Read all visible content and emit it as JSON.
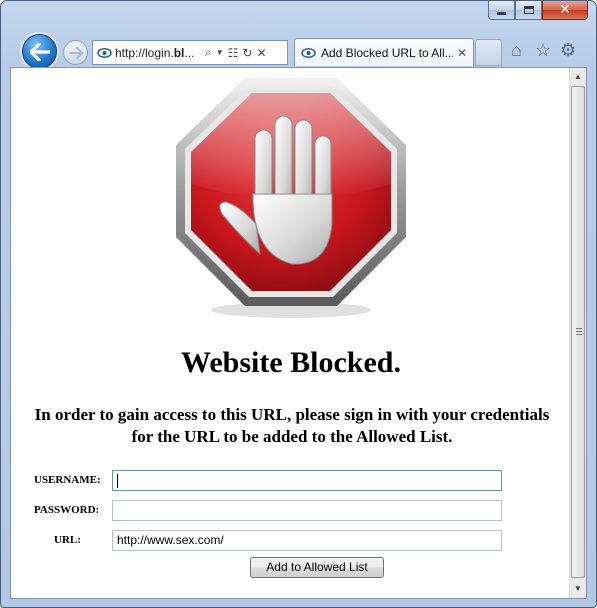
{
  "browser": {
    "address_url_prefix": "http://login.",
    "address_url_bold": "bl",
    "address_url_suffix": "...",
    "tab_title": "Add Blocked URL to All...",
    "icons": {
      "back": "back-arrow-icon",
      "forward": "forward-arrow-icon",
      "page": "ie-page-icon",
      "search": "search-icon",
      "dropdown": "chevron-down-icon",
      "compat": "compatibility-view-icon",
      "refresh": "refresh-icon",
      "stop": "stop-icon",
      "home": "home-icon",
      "favorites": "favorites-star-icon",
      "tools": "gear-icon"
    }
  },
  "page": {
    "logo": "stop-hand-icon",
    "heading": "Website Blocked.",
    "message": "In order to gain access to this URL, please sign in with your credentials for the URL to be added to the Allowed List.",
    "form": {
      "username_label": "USERNAME:",
      "username_value": "",
      "password_label": "PASSWORD:",
      "password_value": "",
      "url_label": "URL:",
      "url_value": "http://www.sex.com/",
      "submit_label": "Add to Allowed List"
    }
  },
  "colors": {
    "stop_red": "#c8161d",
    "frame_blue": "#b9cde8",
    "back_button": "#1f78cf"
  }
}
